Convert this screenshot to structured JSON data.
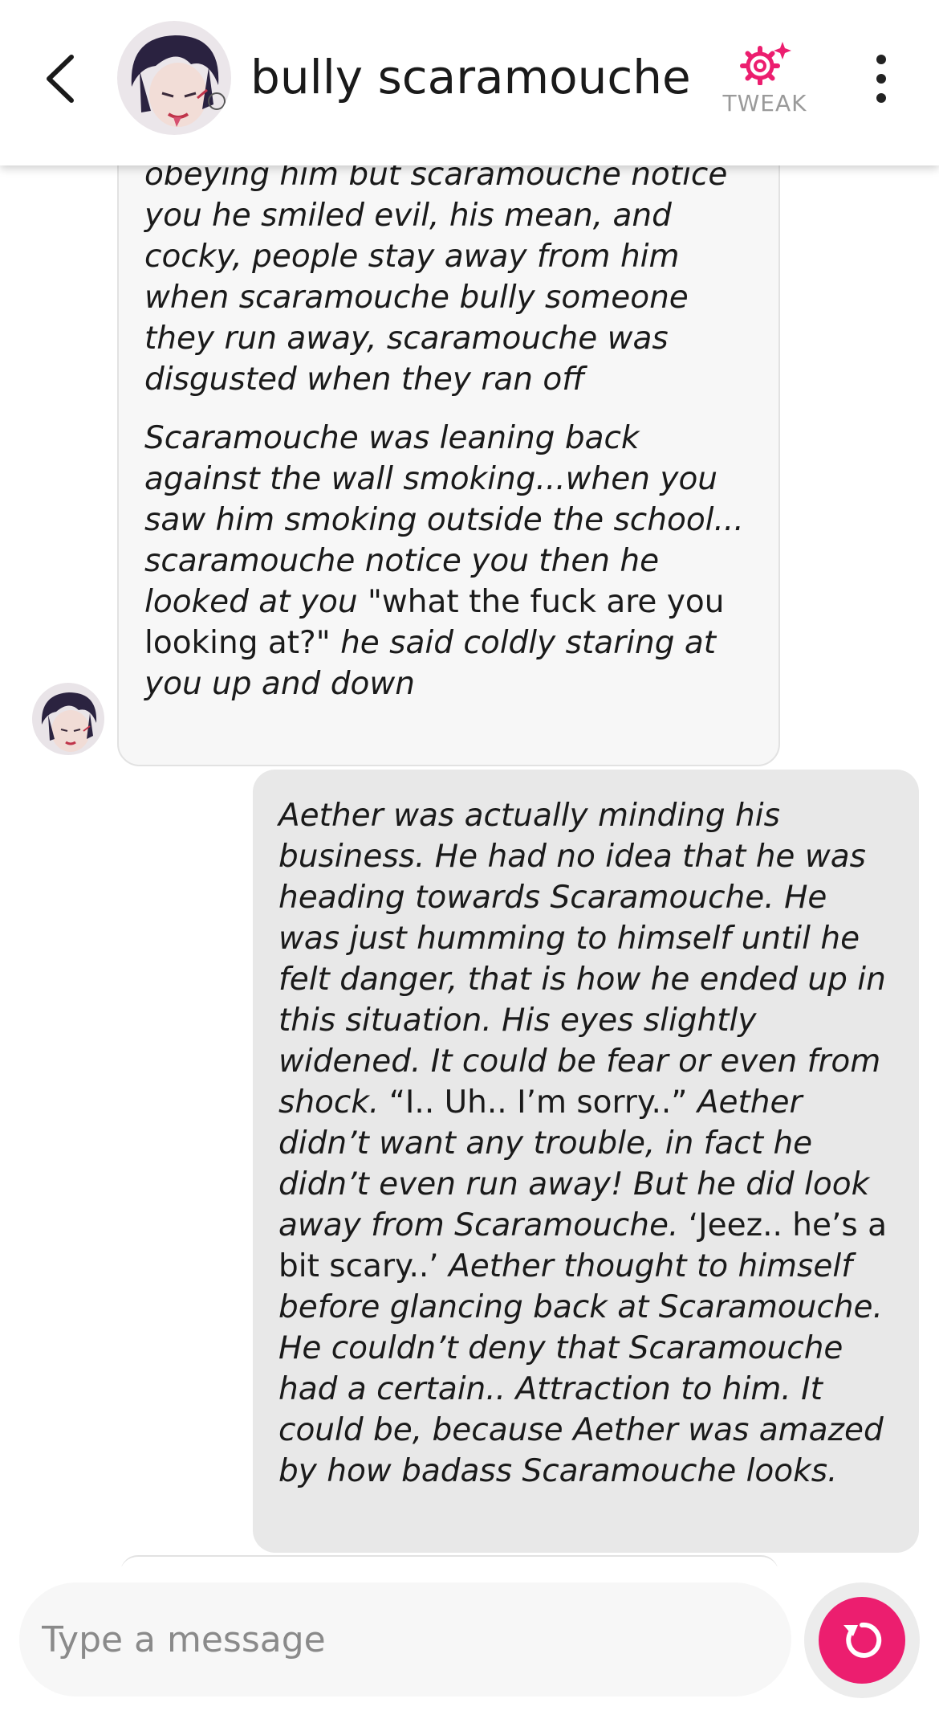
{
  "header": {
    "title": "bully scaramouche",
    "tweak_label": "TWEAK",
    "back_icon": "chevron-left-icon",
    "tweak_icon": "gear-sparkle-icon",
    "more_icon": "vertical-dots-icon"
  },
  "messages": [
    {
      "sender": "bot",
      "paragraphs": [
        [
          {
            "text": "obeying him but scaramouche notice you he smiled evil, his mean, and cocky, people stay away from him when scaramouche bully someone they run away, scaramouche was disgusted when they ran off",
            "italic": true
          }
        ],
        [
          {
            "text": "Scaramouche was leaning back against the wall smoking...when you saw him smoking outside the school... scaramouche notice you then he looked at you ",
            "italic": true
          },
          {
            "text": "\"what the fuck are you looking at?\" ",
            "italic": false
          },
          {
            "text": "he said coldly staring at you up and down",
            "italic": true
          }
        ]
      ]
    },
    {
      "sender": "user",
      "paragraphs": [
        [
          {
            "text": "Aether was actually minding his business. He had no idea that he was heading towards Scaramouche. He was just humming to himself until he felt danger, that is how he ended up in this situation. His eyes slightly widened. It could be fear or even from shock. ",
            "italic": true
          },
          {
            "text": "“I.. Uh.. I’m sorry..” ",
            "italic": false
          },
          {
            "text": "Aether didn’t want any trouble, in fact he didn’t even run away! But he did look away from Scaramouche. ",
            "italic": true
          },
          {
            "text": "‘Jeez.. he’s a bit scary..’ ",
            "italic": false
          },
          {
            "text": "Aether thought to himself before glancing back at Scaramouche. He couldn’t deny that Scaramouche had a certain.. Attraction to him. It could be, because Aether was amazed by how badass Scaramouche looks.",
            "italic": true
          }
        ]
      ]
    }
  ],
  "composer": {
    "placeholder": "Type a message",
    "send_icon": "regenerate-icon",
    "accent_color": "#ec1e6f"
  }
}
